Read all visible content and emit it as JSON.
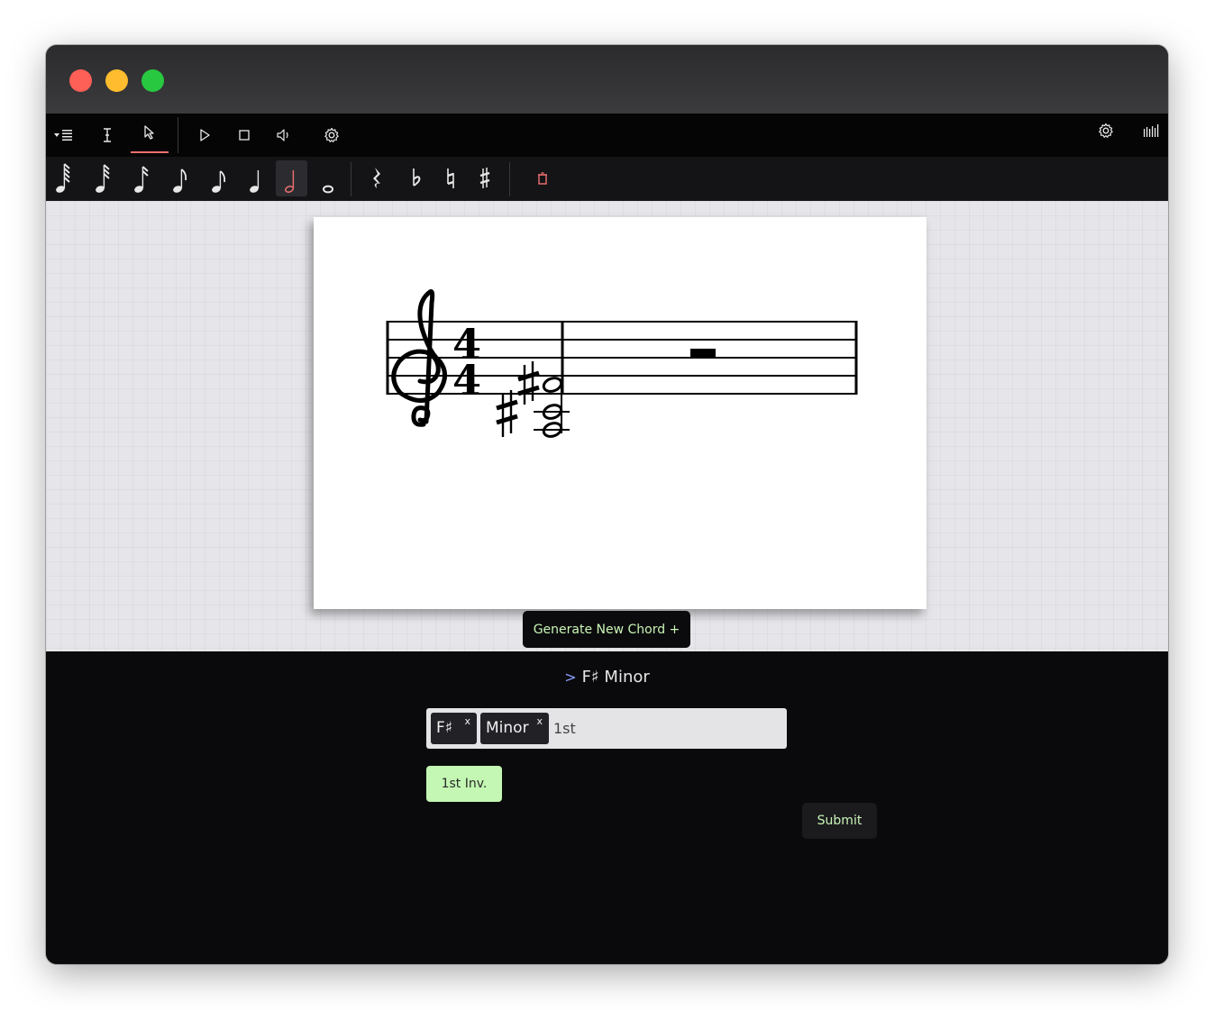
{
  "toolbar": {
    "mode_items": [
      "list-menu-icon",
      "text-cursor-icon",
      "pointer-icon"
    ],
    "playback_items": [
      "play-icon",
      "stop-icon",
      "volume-icon",
      "gear-icon"
    ],
    "right_items": [
      "gear-icon",
      "piano-keys-icon"
    ],
    "active_mode": "pointer",
    "accent_color": "#f07070"
  },
  "palette": {
    "durations": [
      "sixty-fourth-note",
      "thirty-second-note",
      "sixteenth-note",
      "eighth-note",
      "eighth-note-alt",
      "quarter-note",
      "half-note",
      "whole-note"
    ],
    "active_duration": "half-note",
    "modifiers": [
      "rest",
      "flat",
      "natural",
      "sharp"
    ],
    "delete": "trash-icon"
  },
  "score": {
    "clef": "treble",
    "time_signature": "4/4",
    "chord": "F# minor, 1st inversion (A, C#, F#) as half notes with sharps",
    "second_measure": "half rest"
  },
  "generate_button": {
    "label": "Generate New Chord +"
  },
  "chord_panel": {
    "title": "F♯ Minor",
    "chevron": ">",
    "tags": [
      {
        "label": "F♯",
        "remove": "x"
      },
      {
        "label": "Minor",
        "remove": "x"
      }
    ],
    "input_text": "1st",
    "suggestion": "1st Inv.",
    "submit_label": "Submit"
  },
  "colors": {
    "panel_bg": "#0a0a0c",
    "button_text": "#c9f5b7",
    "suggestion_bg": "#c3f7b3"
  }
}
